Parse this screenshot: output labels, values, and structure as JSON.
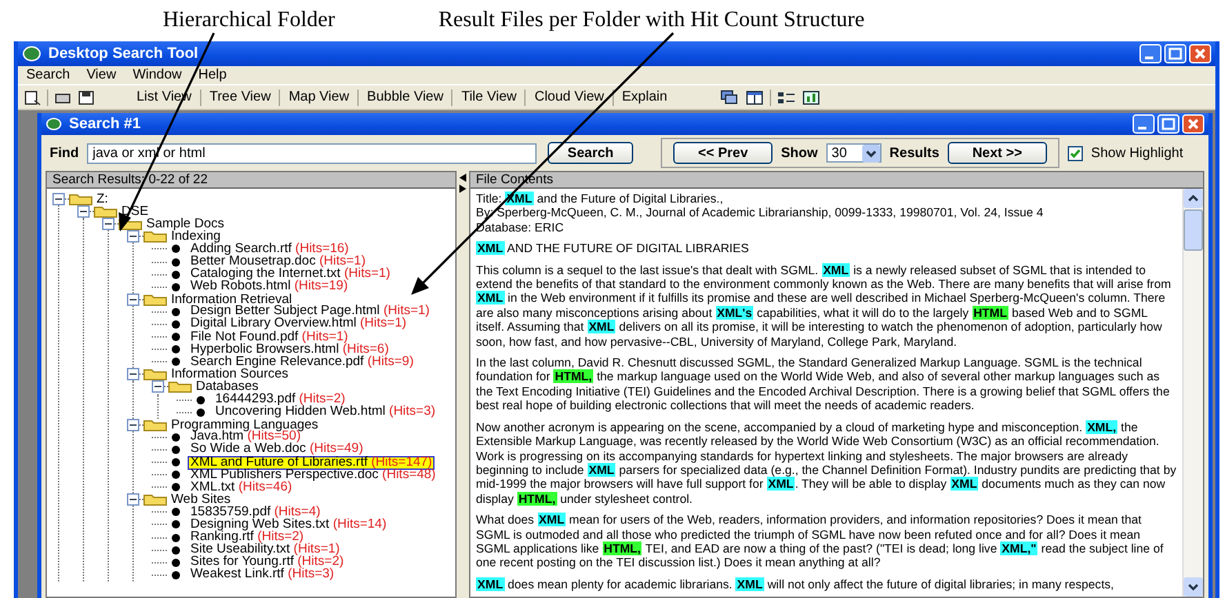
{
  "annotations": [
    "Hierarchical Folder",
    "Result Files per Folder with Hit Count Structure"
  ],
  "window": {
    "title": "Desktop Search Tool"
  },
  "menu": [
    "Search",
    "View",
    "Window",
    "Help"
  ],
  "view_buttons": [
    "List View",
    "Tree View",
    "Map View",
    "Bubble View",
    "Tile View",
    "Cloud View",
    "Explain"
  ],
  "search_window": {
    "title": "Search #1"
  },
  "find": {
    "label": "Find",
    "value": "java or xml or html",
    "button": "Search"
  },
  "paging": {
    "prev": "<< Prev",
    "show_label": "Show",
    "count": "30",
    "results_label": "Results",
    "next": "Next >>"
  },
  "show_highlight": {
    "label": "Show Highlight",
    "checked": true
  },
  "results": {
    "header": "Search Results: 0-22 of 22",
    "tree": [
      {
        "kind": "folder",
        "label": "Z:",
        "expanded": true,
        "children": [
          {
            "kind": "folder",
            "label": "DSE",
            "expanded": true,
            "children": [
              {
                "kind": "folder",
                "label": "Sample Docs",
                "expanded": true,
                "children": [
                  {
                    "kind": "folder",
                    "label": "Indexing",
                    "expanded": true,
                    "children": [
                      {
                        "kind": "file",
                        "name": "Adding Search.rtf",
                        "hits": "(Hits=16)",
                        "selected": false
                      },
                      {
                        "kind": "file",
                        "name": "Better Mousetrap.doc",
                        "hits": "(Hits=1)",
                        "selected": false
                      },
                      {
                        "kind": "file",
                        "name": "Cataloging the Internet.txt",
                        "hits": "(Hits=1)",
                        "selected": false
                      },
                      {
                        "kind": "file",
                        "name": "Web Robots.html",
                        "hits": "(Hits=19)",
                        "selected": false
                      }
                    ]
                  },
                  {
                    "kind": "folder",
                    "label": "Information Retrieval",
                    "expanded": true,
                    "children": [
                      {
                        "kind": "file",
                        "name": "Design Better Subject Page.html",
                        "hits": "(Hits=1)",
                        "selected": false
                      },
                      {
                        "kind": "file",
                        "name": "Digital Library Overview.html",
                        "hits": "(Hits=1)",
                        "selected": false
                      },
                      {
                        "kind": "file",
                        "name": "File Not Found.pdf",
                        "hits": "(Hits=1)",
                        "selected": false
                      },
                      {
                        "kind": "file",
                        "name": "Hyperbolic Browsers.html",
                        "hits": "(Hits=6)",
                        "selected": false
                      },
                      {
                        "kind": "file",
                        "name": "Search Engine Relevance.pdf",
                        "hits": "(Hits=9)",
                        "selected": false
                      }
                    ]
                  },
                  {
                    "kind": "folder",
                    "label": "Information Sources",
                    "expanded": true,
                    "children": [
                      {
                        "kind": "folder",
                        "label": "Databases",
                        "expanded": true,
                        "children": [
                          {
                            "kind": "file",
                            "name": "16444293.pdf",
                            "hits": "(Hits=2)",
                            "selected": false
                          },
                          {
                            "kind": "file",
                            "name": "Uncovering Hidden Web.html",
                            "hits": "(Hits=3)",
                            "selected": false
                          }
                        ]
                      }
                    ]
                  },
                  {
                    "kind": "folder",
                    "label": "Programming Languages",
                    "expanded": true,
                    "children": [
                      {
                        "kind": "file",
                        "name": "Java.htm",
                        "hits": "(Hits=50)",
                        "selected": false
                      },
                      {
                        "kind": "file",
                        "name": "So Wide a Web.doc",
                        "hits": "(Hits=49)",
                        "selected": false
                      },
                      {
                        "kind": "file",
                        "name": "XML and Future of Libraries.rtf",
                        "hits": "(Hits=147)",
                        "selected": true
                      },
                      {
                        "kind": "file",
                        "name": "XML Publishers Perspective.doc",
                        "hits": "(Hits=48)",
                        "selected": false
                      },
                      {
                        "kind": "file",
                        "name": "XML.txt",
                        "hits": "(Hits=46)",
                        "selected": false
                      }
                    ]
                  },
                  {
                    "kind": "folder",
                    "label": "Web Sites",
                    "expanded": true,
                    "children": [
                      {
                        "kind": "file",
                        "name": "15835759.pdf",
                        "hits": "(Hits=4)",
                        "selected": false
                      },
                      {
                        "kind": "file",
                        "name": "Designing Web Sites.txt",
                        "hits": "(Hits=14)",
                        "selected": false
                      },
                      {
                        "kind": "file",
                        "name": "Ranking.rtf",
                        "hits": "(Hits=2)",
                        "selected": false
                      },
                      {
                        "kind": "file",
                        "name": "Site Useability.txt",
                        "hits": "(Hits=1)",
                        "selected": false
                      },
                      {
                        "kind": "file",
                        "name": "Sites for Young.rtf",
                        "hits": "(Hits=2)",
                        "selected": false
                      },
                      {
                        "kind": "file",
                        "name": "Weakest Link.rtf",
                        "hits": "(Hits=3)",
                        "selected": false
                      }
                    ]
                  }
                ]
              }
            ]
          }
        ]
      }
    ]
  },
  "content": {
    "header": "File Contents",
    "meta": [
      [
        {
          "text": "Title: "
        },
        {
          "text": "XML",
          "color": "#33ffff"
        },
        {
          "text": " and the Future of Digital Libraries.,"
        }
      ],
      [
        {
          "text": "By: Sperberg-McQueen, C. M., Journal of Academic Librarianship, 0099-1333, 19980701, Vol. 24, Issue 4"
        }
      ],
      [
        {
          "text": "Database: ERIC"
        }
      ]
    ],
    "paragraphs": [
      [
        {
          "text": "XML",
          "color": "#33ffff"
        },
        {
          "text": " AND THE FUTURE OF DIGITAL LIBRARIES"
        }
      ],
      [
        {
          "text": "This column is a sequel to the last issue's that dealt with SGML. "
        },
        {
          "text": "XML",
          "color": "#33ffff"
        },
        {
          "text": " is a newly released subset of SGML that is intended to extend the benefits of that standard to the environment commonly known as the Web. There are many benefits that will arise from "
        },
        {
          "text": "XML",
          "color": "#33ffff"
        },
        {
          "text": " in the Web environment if it fulfills its promise and these are well described in Michael Sperberg-McQueen's column. There are also many misconceptions arising about "
        },
        {
          "text": "XML's",
          "color": "#33ffff"
        },
        {
          "text": " capabilities, what it will do to the largely "
        },
        {
          "text": "HTML",
          "color": "#33ff33"
        },
        {
          "text": " based Web and to SGML itself. Assuming that "
        },
        {
          "text": "XML",
          "color": "#33ffff"
        },
        {
          "text": " delivers on all its promise, it will be interesting to watch the phenomenon of adoption, particularly how soon, how fast, and how pervasive--CBL, University of Maryland, College Park, Maryland."
        }
      ],
      [
        {
          "text": "In the last column, David R. Chesnutt discussed SGML, the Standard Generalized Markup Language. SGML is the technical foundation for "
        },
        {
          "text": "HTML,",
          "color": "#33ff33"
        },
        {
          "text": " the markup language used on the World Wide Web, and also of several other markup languages such as the Text Encoding Initiative (TEI) Guidelines and the Encoded Archival Description. There is a growing belief that SGML offers the best real hope of building electronic collections that will meet the needs of academic readers."
        }
      ],
      [
        {
          "text": "Now another acronym is appearing on the scene, accompanied by a cloud of marketing hype and misconception. "
        },
        {
          "text": "XML,",
          "color": "#33ffff"
        },
        {
          "text": " the Extensible Markup Language, was recently released by the World Wide Web Consortium (W3C) as an official recommendation. Work is progressing on its accompanying standards for hypertext linking and stylesheets. The major browsers are already beginning to include "
        },
        {
          "text": "XML",
          "color": "#33ffff"
        },
        {
          "text": " parsers for specialized data (e.g., the Channel Definition Format). Industry pundits are predicting that by mid-1999 the major browsers will have full support for "
        },
        {
          "text": "XML",
          "color": "#33ffff"
        },
        {
          "text": ". They will be able to display "
        },
        {
          "text": "XML",
          "color": "#33ffff"
        },
        {
          "text": " documents much as they can now display "
        },
        {
          "text": "HTML,",
          "color": "#33ff33"
        },
        {
          "text": " under stylesheet control."
        }
      ],
      [
        {
          "text": "What does "
        },
        {
          "text": "XML",
          "color": "#33ffff"
        },
        {
          "text": " mean for users of the Web, readers, information providers, and information repositories? Does it mean that SGML is outmoded and all those who predicted the triumph of SGML have now been refuted once and for all? Does it mean SGML applications like "
        },
        {
          "text": "HTML,",
          "color": "#33ff33"
        },
        {
          "text": " TEI, and EAD are now a thing of the past? (\"TEI is dead; long live "
        },
        {
          "text": "XML,\"",
          "color": "#33ffff"
        },
        {
          "text": " read the subject line of one recent posting on the TEI discussion list.) Does it mean anything at all?"
        }
      ],
      [
        {
          "text": "XML",
          "color": "#33ffff"
        },
        {
          "text": " does mean plenty for academic librarians. "
        },
        {
          "text": "XML",
          "color": "#33ffff"
        },
        {
          "text": " will not only affect the future of digital libraries; in many respects,"
        }
      ]
    ]
  }
}
